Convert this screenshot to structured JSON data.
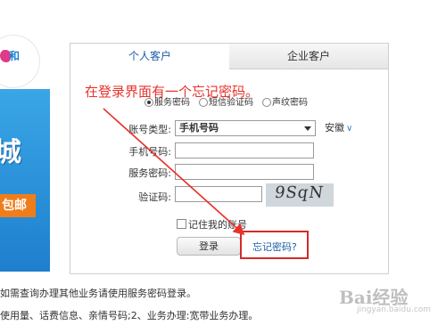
{
  "banner": {
    "logo_text": "和",
    "big_text": "城",
    "tag_text": "包邮"
  },
  "tabs": [
    {
      "label": "个人客户",
      "active": true
    },
    {
      "label": "企业客户",
      "active": false
    }
  ],
  "annotation": "在登录界面有一个忘记密码。",
  "login_type": {
    "options": [
      "服务密码",
      "短信验证码",
      "声纹密码"
    ],
    "selected": "服务密码"
  },
  "form": {
    "account_type_label": "账号类型:",
    "account_type_value": "手机号码",
    "province": "安徽",
    "phone_label": "手机号码:",
    "password_label": "服务密码:",
    "captcha_label": "验证码:",
    "captcha_text": "9SqN",
    "remember_label": "记住我的账号",
    "login_button": "登录",
    "forgot_link": "忘记密码?"
  },
  "notes": [
    "如需查询办理其他业务请使用服务密码登录。",
    "使用量、话费信息、亲情号码;2、业务办理:宽带业务办理。"
  ],
  "watermark": {
    "main": "Bai经验",
    "sub": "jingyan.baidu.com"
  },
  "colors": {
    "annotation_red": "#e8322c",
    "link_blue": "#1a5ea8",
    "banner_blue": "#1e7fce",
    "tag_orange": "#ef7d1a"
  }
}
